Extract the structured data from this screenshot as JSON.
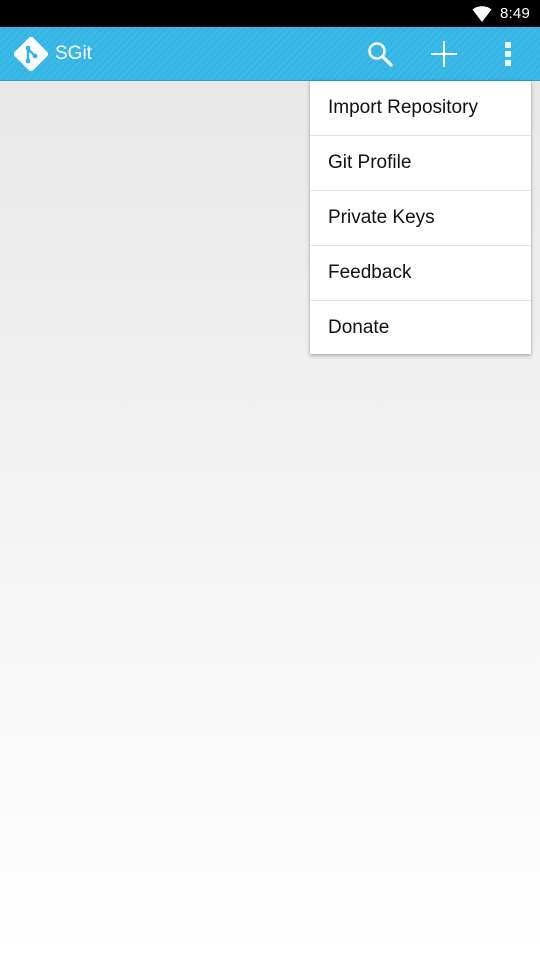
{
  "status_bar": {
    "time": "8:49",
    "icons": [
      "wifi-icon"
    ]
  },
  "app_bar": {
    "title": "SGit",
    "logo": "git-logo-icon",
    "actions": [
      "search-icon",
      "add-icon",
      "overflow-menu-icon"
    ],
    "color": "#33b5e5"
  },
  "overflow_menu": {
    "items": [
      {
        "label": "Import Repository"
      },
      {
        "label": "Git Profile"
      },
      {
        "label": "Private Keys"
      },
      {
        "label": "Feedback"
      },
      {
        "label": "Donate"
      }
    ]
  }
}
